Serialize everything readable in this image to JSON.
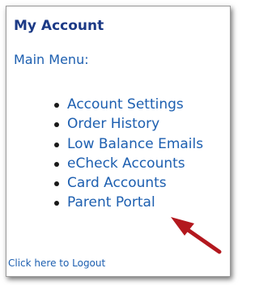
{
  "panel": {
    "title": "My Account",
    "menu_label": "Main Menu:",
    "menu_items": [
      {
        "label": "Account Settings"
      },
      {
        "label": "Order History"
      },
      {
        "label": "Low Balance Emails"
      },
      {
        "label": "eCheck Accounts"
      },
      {
        "label": "Card Accounts"
      },
      {
        "label": "Parent Portal"
      }
    ],
    "logout_label": "Click here to Logout"
  },
  "annotation": {
    "arrow_color": "#b3181e",
    "points_to": "Parent Portal"
  },
  "colors": {
    "title": "#1c3a86",
    "link": "#1d5fb0"
  }
}
